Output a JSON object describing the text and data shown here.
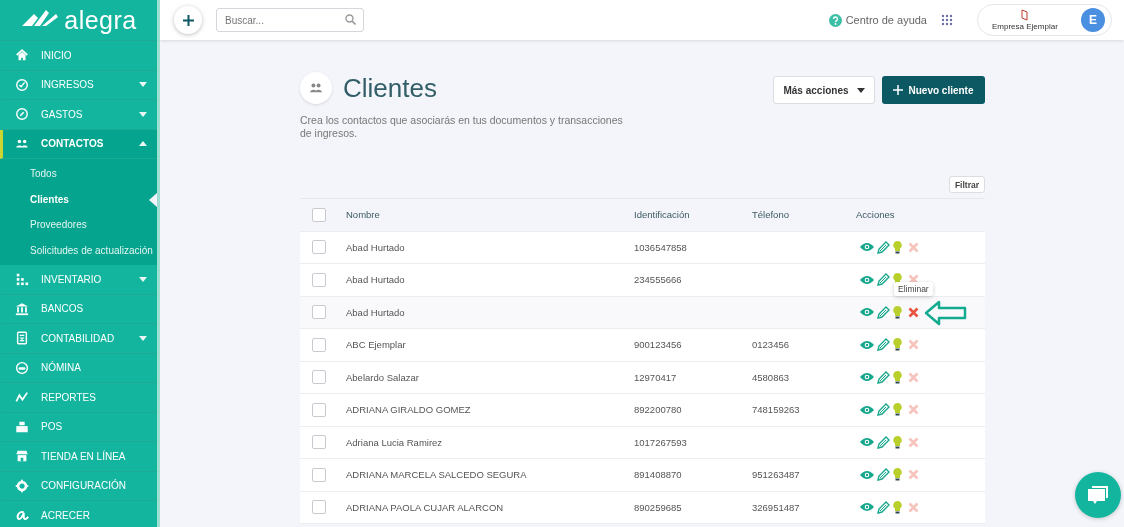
{
  "sidebar": {
    "logo_text": "alegra",
    "items": [
      {
        "label": "INICIO",
        "kind": "link",
        "selected": false
      },
      {
        "label": "INGRESOS",
        "kind": "group",
        "expanded": false,
        "selected": false
      },
      {
        "label": "GASTOS",
        "kind": "group",
        "expanded": false,
        "selected": false
      },
      {
        "label": "CONTACTOS",
        "kind": "group",
        "expanded": true,
        "selected": true,
        "children": [
          {
            "label": "Todos",
            "selected": false
          },
          {
            "label": "Clientes",
            "selected": true
          },
          {
            "label": "Proveedores",
            "selected": false
          },
          {
            "label": "Solicitudes de actualización",
            "selected": false
          }
        ]
      },
      {
        "label": "INVENTARIO",
        "kind": "group",
        "expanded": false,
        "selected": false
      },
      {
        "label": "BANCOS",
        "kind": "link",
        "selected": false
      },
      {
        "label": "CONTABILIDAD",
        "kind": "group",
        "expanded": false,
        "selected": false
      },
      {
        "label": "NÓMINA",
        "kind": "link",
        "selected": false
      },
      {
        "label": "REPORTES",
        "kind": "link",
        "selected": false
      },
      {
        "label": "POS",
        "kind": "link",
        "selected": false
      },
      {
        "label": "TIENDA EN LÍNEA",
        "kind": "link",
        "selected": false
      },
      {
        "label": "CONFIGURACIÓN",
        "kind": "link",
        "selected": false
      },
      {
        "label": "ACRECER",
        "kind": "link",
        "selected": false
      }
    ]
  },
  "topbar": {
    "search": {
      "placeholder": "Buscar..."
    },
    "help": "Centro de ayuda",
    "company": "Empresa Ejemplar",
    "avatar": "E"
  },
  "page": {
    "title": "Clientes",
    "description": "Crea los contactos que asociarás en tus documentos y transacciones de ingresos.",
    "more_actions": "Más acciones",
    "new_button": "Nuevo cliente",
    "filter": "Filtrar"
  },
  "table": {
    "header_checked": false,
    "columns": [
      "Nombre",
      "Identificación",
      "Télefono",
      "Acciones"
    ],
    "rows": [
      {
        "name": "Abad Hurtado",
        "id": "1036547858",
        "phone": "",
        "checked": false,
        "hovered": false
      },
      {
        "name": "Abad Hurtado",
        "id": "234555666",
        "phone": "",
        "checked": false,
        "hovered": false
      },
      {
        "name": "Abad Hurtado",
        "id": "",
        "phone": "",
        "checked": false,
        "hovered": true,
        "tooltip": "Eliminar"
      },
      {
        "name": "ABC Ejemplar",
        "id": "900123456",
        "phone": "0123456",
        "checked": false,
        "hovered": false
      },
      {
        "name": "Abelardo Salazar",
        "id": "12970417",
        "phone": "4580863",
        "checked": false,
        "hovered": false
      },
      {
        "name": "ADRIANA GIRALDO GOMEZ",
        "id": "892200780",
        "phone": "748159263",
        "checked": false,
        "hovered": false
      },
      {
        "name": "Adriana Lucia Ramirez",
        "id": "1017267593",
        "phone": "",
        "checked": false,
        "hovered": false
      },
      {
        "name": "ADRIANA MARCELA SALCEDO SEGURA",
        "id": "891408870",
        "phone": "951263487",
        "checked": false,
        "hovered": false
      },
      {
        "name": "ADRIANA PAOLA CUJAR ALARCON",
        "id": "890259685",
        "phone": "326951487",
        "checked": false,
        "hovered": false
      }
    ]
  }
}
